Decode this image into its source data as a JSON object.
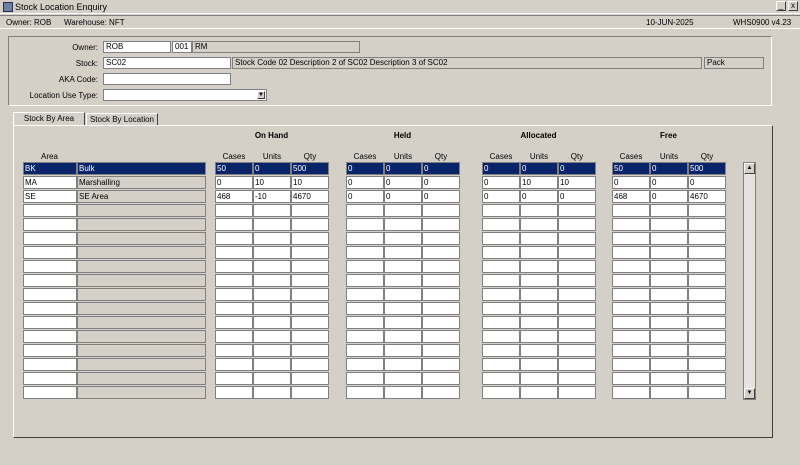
{
  "window": {
    "title": "Stock Location Enquiry",
    "minimize_glyph": "_",
    "close_glyph": "x"
  },
  "infobar": {
    "owner": "Owner:  ROB",
    "warehouse": "Warehouse:  NFT",
    "date": "10-JUN-2025",
    "version": "WHS0900  v4.23"
  },
  "header": {
    "owner_label": "Owner:",
    "owner_code": "ROB",
    "owner_num": "001",
    "owner_name": "RM",
    "stock_label": "Stock:",
    "stock_code": "SC02",
    "stock_desc": "Stock Code 02 Description 2 of SC02 Description 3 of SC02",
    "stock_uom": "Pack",
    "aka_label": "AKA Code:",
    "aka_value": "",
    "loc_use_label": "Location Use Type:",
    "loc_use_value": ""
  },
  "tabs": [
    {
      "label": "Stock By Area",
      "active": true
    },
    {
      "label": "Stock By Location",
      "active": false
    }
  ],
  "grid": {
    "groups": [
      "On Hand",
      "Held",
      "Allocated",
      "Free"
    ],
    "area_header": "Area",
    "sub_headers": [
      "Cases",
      "Units",
      "Qty"
    ],
    "rows": [
      {
        "code": "BK",
        "name": "Bulk",
        "on_hand": [
          "50",
          "0",
          "500"
        ],
        "held": [
          "0",
          "0",
          "0"
        ],
        "allocated": [
          "0",
          "0",
          "0"
        ],
        "free": [
          "50",
          "0",
          "500"
        ]
      },
      {
        "code": "MA",
        "name": "Marshalling",
        "on_hand": [
          "0",
          "10",
          "10"
        ],
        "held": [
          "0",
          "0",
          "0"
        ],
        "allocated": [
          "0",
          "10",
          "10"
        ],
        "free": [
          "0",
          "0",
          "0"
        ]
      },
      {
        "code": "SE",
        "name": "SE Area",
        "on_hand": [
          "468",
          "-10",
          "4670"
        ],
        "held": [
          "0",
          "0",
          "0"
        ],
        "allocated": [
          "0",
          "0",
          "0"
        ],
        "free": [
          "468",
          "0",
          "4670"
        ]
      }
    ],
    "empty_rows": 14
  },
  "scrollbar": {
    "up_glyph": "▲",
    "down_glyph": "▼"
  },
  "colors": {
    "background": "#d4d0c8",
    "selection": "#0a246a",
    "field": "#ffffff"
  }
}
